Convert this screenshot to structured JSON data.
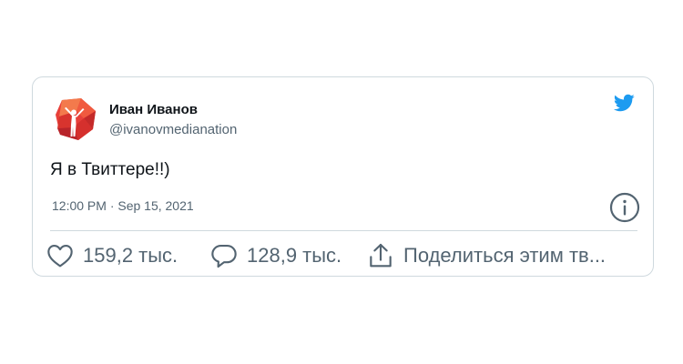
{
  "tweet": {
    "author_name": "Иван Иванов",
    "author_handle": "@ivanovmedianation",
    "text": "Я в Твиттере!!)",
    "timestamp": "12:00 PM · Sep 15, 2021"
  },
  "actions": {
    "like_count": "159,2 тыс.",
    "reply_count": "128,9 тыс.",
    "share_label": "Поделиться этим тв..."
  },
  "icons": {
    "brand": "twitter-bird-icon",
    "info": "info-icon",
    "like": "heart-icon",
    "reply": "comment-bubble-icon",
    "share": "share-upload-icon",
    "avatar": "red-polygon-avatar-with-figure"
  },
  "colors": {
    "twitter_blue": "#1d9bf0",
    "text_primary": "#0f1419",
    "text_secondary": "#536471",
    "border": "#cfd9de",
    "avatar_red": "#e8403a"
  }
}
